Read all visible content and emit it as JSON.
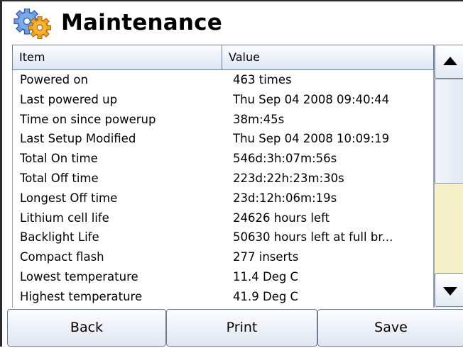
{
  "title": "Maintenance",
  "table": {
    "headers": {
      "item": "Item",
      "value": "Value"
    },
    "rows": [
      {
        "item": "Powered on",
        "value": "463 times"
      },
      {
        "item": "Last powered up",
        "value": "Thu Sep 04 2008 09:40:44"
      },
      {
        "item": "Time on since powerup",
        "value": "38m:45s"
      },
      {
        "item": "Last Setup Modified",
        "value": "Thu Sep 04 2008 10:09:19"
      },
      {
        "item": "Total On time",
        "value": "546d:3h:07m:56s"
      },
      {
        "item": "Total Off time",
        "value": "223d:22h:23m:30s"
      },
      {
        "item": "Longest Off time",
        "value": "23d:12h:06m:19s"
      },
      {
        "item": "Lithium cell life",
        "value": "24626 hours left"
      },
      {
        "item": "Backlight Life",
        "value": "50630 hours left at full br..."
      },
      {
        "item": "Compact flash",
        "value": "277 inserts"
      },
      {
        "item": "Lowest temperature",
        "value": "11.4 Deg C"
      },
      {
        "item": "Highest temperature",
        "value": "41.9 Deg C"
      }
    ]
  },
  "buttons": {
    "back": "Back",
    "print": "Print",
    "save": "Save"
  },
  "icons": {
    "title": "gears-icon",
    "scroll_up": "arrow-up-icon",
    "scroll_down": "arrow-down-icon"
  },
  "colors": {
    "scroll_track": "#f5f0c8",
    "gear_orange": "#f2a31b",
    "gear_blue": "#5b8fd6"
  }
}
